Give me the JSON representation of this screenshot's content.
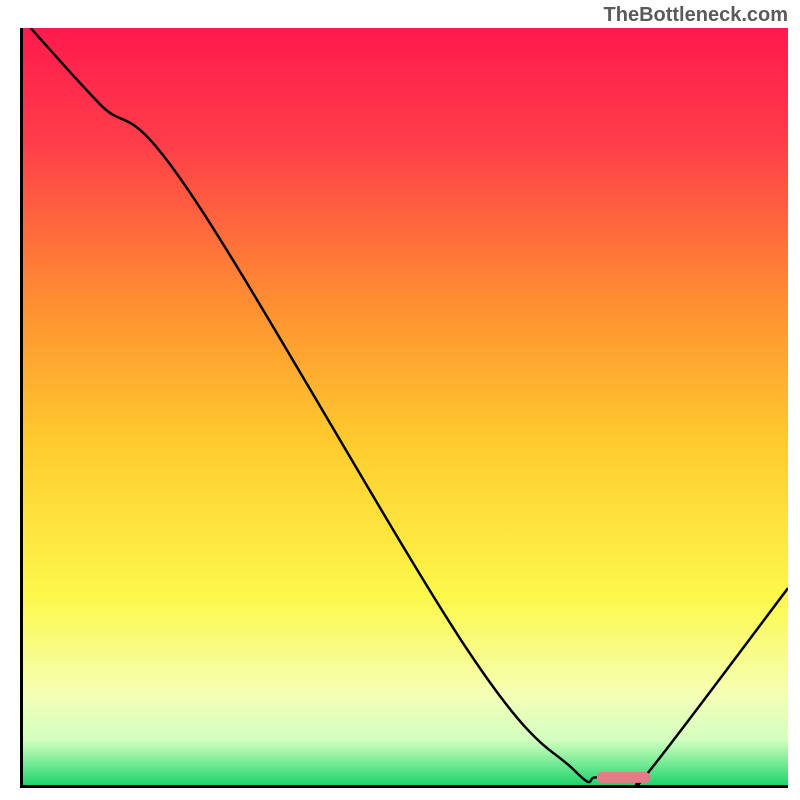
{
  "watermark": "TheBottleneck.com",
  "chart_data": {
    "type": "line",
    "title": "",
    "xlabel": "",
    "ylabel": "",
    "xlim": [
      0,
      100
    ],
    "ylim": [
      0,
      100
    ],
    "grid": false,
    "background_gradient": {
      "stops": [
        {
          "pos": 0.0,
          "color": "#ff1a4d"
        },
        {
          "pos": 0.15,
          "color": "#ff3d4a"
        },
        {
          "pos": 0.35,
          "color": "#ff8a33"
        },
        {
          "pos": 0.55,
          "color": "#ffcc2e"
        },
        {
          "pos": 0.75,
          "color": "#fdf84a"
        },
        {
          "pos": 0.88,
          "color": "#f5ffb5"
        },
        {
          "pos": 0.94,
          "color": "#d4ffc0"
        },
        {
          "pos": 0.975,
          "color": "#6be890"
        },
        {
          "pos": 1.0,
          "color": "#1fd46c"
        }
      ]
    },
    "series": [
      {
        "name": "bottleneck-curve",
        "color": "#000000",
        "x": [
          1,
          10,
          22,
          58,
          72,
          75,
          80,
          82,
          100
        ],
        "y": [
          100,
          90,
          78,
          18,
          2,
          1,
          1,
          2,
          26
        ]
      }
    ],
    "marker": {
      "name": "optimal-range",
      "x_start": 75,
      "x_end": 82,
      "y": 1,
      "color": "#e87a88"
    }
  }
}
